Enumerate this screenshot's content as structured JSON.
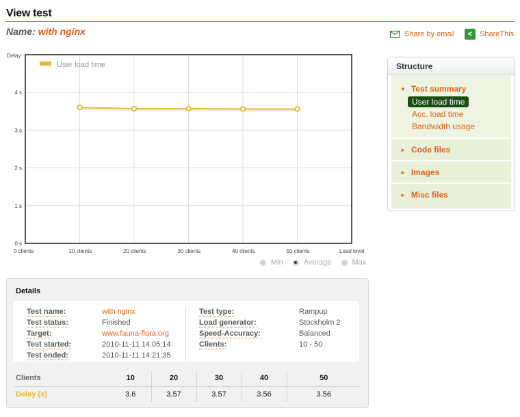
{
  "page": {
    "title": "View test",
    "name_label": "Name:",
    "name_value": "with nginx"
  },
  "share": {
    "email_label": "Share by email",
    "email_icon": "mail-icon",
    "sharethis_label": "ShareThis",
    "sharethis_icon": "share-icon"
  },
  "colors": {
    "accent_orange": "#e0601a",
    "series_yellow": "#e8b930",
    "title_rule_green": "#7ba23a",
    "active_item_green": "#1c4c15",
    "panel_green": "#e9f2d9"
  },
  "chart_data": {
    "type": "line",
    "title": "",
    "ylabel": "Delay",
    "xlabel": "Load level",
    "x_tick_labels": [
      "0 clients",
      "10 clients",
      "20 clients",
      "30 clients",
      "40 clients",
      "50 clients"
    ],
    "x_ticks": [
      0,
      10,
      20,
      30,
      40,
      50
    ],
    "xlim": [
      0,
      60
    ],
    "y_tick_labels": [
      "0 s",
      "1 s",
      "2 s",
      "3 s",
      "4 s"
    ],
    "y_ticks": [
      0,
      1,
      2,
      3,
      4
    ],
    "ylim": [
      0,
      5
    ],
    "grid": true,
    "legend_position": "top-left",
    "series": [
      {
        "name": "User load time",
        "color": "#e8b930",
        "x": [
          10,
          20,
          30,
          40,
          50
        ],
        "values": [
          3.6,
          3.57,
          3.57,
          3.56,
          3.56
        ]
      }
    ],
    "mode_options": [
      {
        "label": "Min",
        "selected": false
      },
      {
        "label": "Average",
        "selected": true
      },
      {
        "label": "Max",
        "selected": false
      }
    ]
  },
  "structure": {
    "title": "Structure",
    "sections": [
      {
        "label": "Test summary",
        "expanded": true,
        "items": [
          {
            "label": "User load time",
            "active": true
          },
          {
            "label": "Acc. load time",
            "active": false
          },
          {
            "label": "Bandwidth usage",
            "active": false
          }
        ]
      },
      {
        "label": "Code files",
        "expanded": false
      },
      {
        "label": "Images",
        "expanded": false
      },
      {
        "label": "Misc files",
        "expanded": false
      }
    ]
  },
  "details": {
    "title": "Details",
    "left": [
      {
        "label": "Test name:",
        "value": "with nginx",
        "link": true
      },
      {
        "label": "Test status:",
        "value": "Finished",
        "link": false
      },
      {
        "label": "Target:",
        "value": "www.fauna-flora.org",
        "link": true
      },
      {
        "label": "Test started:",
        "value": "2010-11-11 14:05:14",
        "link": false
      },
      {
        "label": "Test ended:",
        "value": "2010-11-11 14:21:35",
        "link": false
      }
    ],
    "right": [
      {
        "label": "Test type:",
        "value": "Rampup"
      },
      {
        "label": "Load generator:",
        "value": "Stockholm 2"
      },
      {
        "label": "Speed-Accuracy:",
        "value": "Balanced"
      },
      {
        "label": "Clients:",
        "value": "10 - 50"
      }
    ],
    "table": {
      "header_label": "Clients",
      "clients": [
        "10",
        "20",
        "30",
        "40",
        "50"
      ],
      "row_label": "Delay (s)",
      "delays": [
        "3.6",
        "3.57",
        "3.57",
        "3.56",
        "3.56"
      ]
    }
  }
}
